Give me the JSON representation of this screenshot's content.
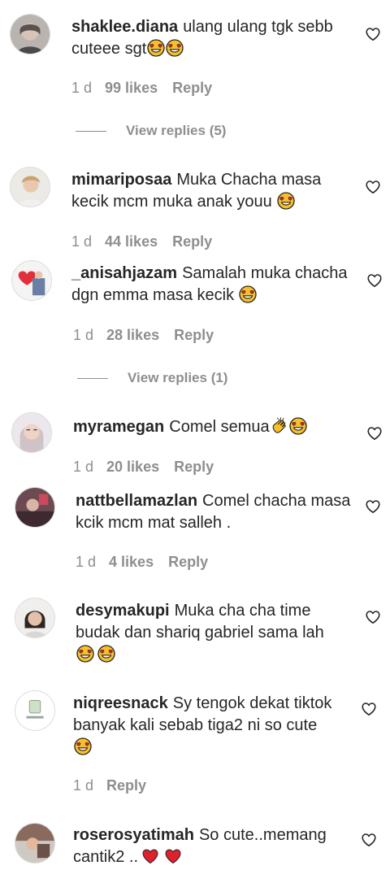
{
  "comments": [
    {
      "username": "shaklee.diana",
      "text": "ulang ulang tgk sebb cuteee sgt",
      "time": "1 d",
      "likes": "99 likes",
      "reply": "Reply",
      "view_replies": "View replies (5)"
    },
    {
      "username": "mimariposaa",
      "text": "Muka Chacha masa kecik mcm muka anak youu",
      "time": "1 d",
      "likes": "44 likes",
      "reply": "Reply"
    },
    {
      "username": "_anisahjazam",
      "text": "Samalah muka chacha dgn emma masa kecik",
      "time": "1 d",
      "likes": "28 likes",
      "reply": "Reply",
      "view_replies": "View replies (1)"
    },
    {
      "username": "myramegan",
      "text": "Comel semua",
      "time": "1 d",
      "likes": "20 likes",
      "reply": "Reply"
    },
    {
      "username": "nattbellamazlan",
      "text": "Comel chacha masa kcik mcm mat salleh .",
      "time": "1 d",
      "likes": "4 likes",
      "reply": "Reply"
    },
    {
      "username": "desymakupi",
      "text": "Muka cha cha time budak dan shariq gabriel sama lah",
      "time": "",
      "likes": "",
      "reply": ""
    },
    {
      "username": "niqreesnack",
      "text": "Sy tengok dekat tiktok banyak kali sebab tiga2 ni so cute",
      "time": "1 d",
      "likes": "",
      "reply": "Reply"
    },
    {
      "username": "roserosyatimah",
      "text": "So cute..memang cantik2 ..",
      "time": "",
      "likes": "",
      "reply": ""
    }
  ],
  "icons": {
    "like": "heart-outline-icon",
    "heart_eyes": "heart-eyes-emoji",
    "clap": "clapping-hands-emoji",
    "red_heart": "red-heart-emoji"
  },
  "colors": {
    "text": "#262626",
    "secondary": "#8e8e8e",
    "emoji_yellow": "#f7c02b",
    "heart_red": "#e0202e"
  }
}
